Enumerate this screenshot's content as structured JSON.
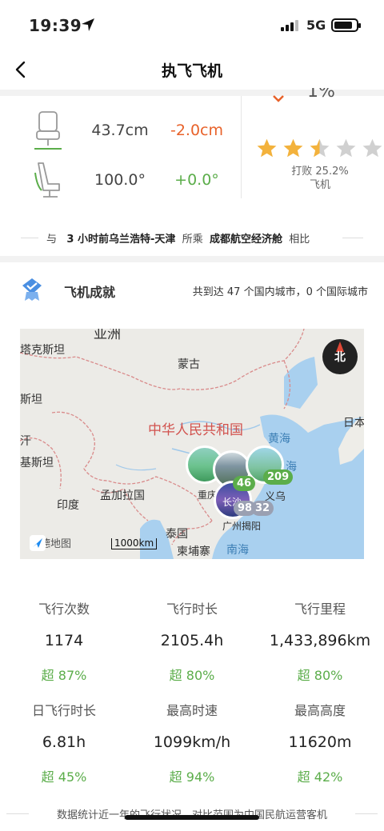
{
  "status_bar": {
    "time": "19:39",
    "network": "5G"
  },
  "nav": {
    "title": "执飞飞机"
  },
  "seat": {
    "pitch": {
      "value": "43.7cm",
      "diff": "-2.0cm",
      "diff_color": "#e8622a"
    },
    "recline": {
      "value": "100.0°",
      "diff": "+0.0°",
      "diff_color": "#5bad4a"
    }
  },
  "rating": {
    "stars": 2.5,
    "max": 5,
    "beat_text": "打败 25.2%",
    "beat_subject": "飞机",
    "top_partial": "1%"
  },
  "compare": {
    "prefix": "与",
    "flight": "3 小时前乌兰浩特-天津",
    "mid": "所乘",
    "airline": "成都航空经济舱",
    "suffix": "相比"
  },
  "achievement": {
    "title": "飞机成就",
    "summary": "共到达 47 个国内城市，0 个国际城市"
  },
  "map": {
    "labels": {
      "asia": "亚洲",
      "tajik": "塔克斯坦",
      "mongolia": "蒙古",
      "stan": "斯坦",
      "china": "中华人民共和国",
      "yellow_sea": "黄海",
      "japan": "日本",
      "han": "汗",
      "kistan": "基斯坦",
      "east_sea": "海",
      "bangladesh": "孟加拉国",
      "india": "印度",
      "chongqing": "重庆",
      "yiwu": "义乌",
      "changsha": "长沙",
      "guangzhou": "广州",
      "jieyang": "揭阳",
      "thailand": "泰国",
      "cambodia": "柬埔寨",
      "south_sea": "南海"
    },
    "badges": [
      "46",
      "209",
      "98",
      "32"
    ],
    "logo": "高德地图",
    "scale": "1000km",
    "compass": "北"
  },
  "stats": [
    {
      "label": "飞行次数",
      "value": "1174",
      "rank": "超 87%"
    },
    {
      "label": "飞行时长",
      "value": "2105.4h",
      "rank": "超 80%"
    },
    {
      "label": "飞行里程",
      "value": "1,433,896km",
      "rank": "超 80%"
    },
    {
      "label": "日飞行时长",
      "value": "6.81h",
      "rank": "超 45%"
    },
    {
      "label": "最高时速",
      "value": "1099km/h",
      "rank": "超 94%"
    },
    {
      "label": "最高高度",
      "value": "11620m",
      "rank": "超 42%"
    }
  ],
  "footer": {
    "text": "数据统计近一年的飞行状况，对比范围为中国民航运营客机"
  },
  "colors": {
    "accent_green": "#5bad4a",
    "accent_orange": "#e8622a",
    "star_gold": "#f3b23c",
    "star_gray": "#d0d0d0",
    "badge_blue": "#3f7fe0"
  }
}
